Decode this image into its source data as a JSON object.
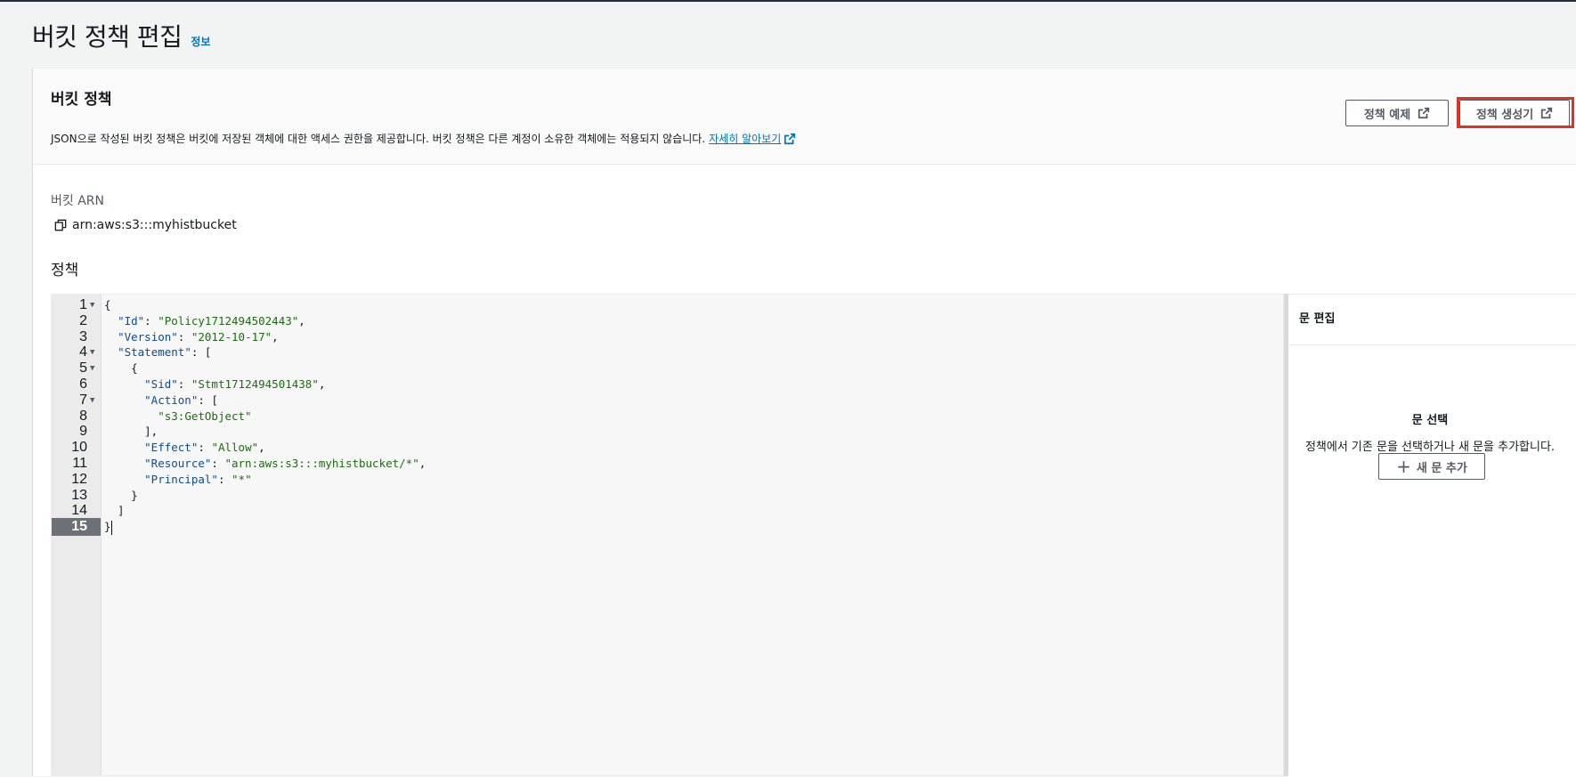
{
  "page": {
    "title": "버킷 정책 편집",
    "info_link": "정보"
  },
  "panel": {
    "title": "버킷 정책",
    "description": "JSON으로 작성된 버킷 정책은 버킷에 저장된 객체에 대한 액세스 권한을 제공합니다. 버킷 정책은 다른 계정이 소유한 객체에는 적용되지 않습니다.",
    "learn_more": "자세히 알아보기",
    "buttons": {
      "policy_examples": "정책 예제",
      "policy_generator": "정책 생성기"
    },
    "highlight_color": "#e0341e"
  },
  "arn": {
    "label": "버킷 ARN",
    "value": "arn:aws:s3:::myhistbucket"
  },
  "policy": {
    "label": "정책",
    "active_line": 15,
    "lines": [
      "{",
      "  \"Id\": \"Policy1712494502443\",",
      "  \"Version\": \"2012-10-17\",",
      "  \"Statement\": [",
      "    {",
      "      \"Sid\": \"Stmt1712494501438\",",
      "      \"Action\": [",
      "        \"s3:GetObject\"",
      "      ],",
      "      \"Effect\": \"Allow\",",
      "      \"Resource\": \"arn:aws:s3:::myhistbucket/*\",",
      "      \"Principal\": \"*\"",
      "    }",
      "  ]",
      "}"
    ],
    "foldable_lines": [
      1,
      4,
      5,
      7
    ]
  },
  "statement_editor": {
    "title": "문 편집",
    "empty_title": "문 선택",
    "empty_desc": "정책에서 기존 문을 선택하거나 새 문을 추가합니다.",
    "add_button": "새 문 추가"
  }
}
